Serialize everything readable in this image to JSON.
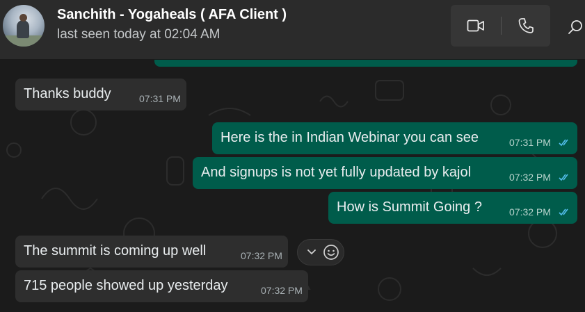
{
  "header": {
    "contact_name": "Sanchith - Yogaheals ( AFA Client )",
    "last_seen": "last seen today at 02:04 AM",
    "buttons": [
      "video-call-icon",
      "voice-call-icon",
      "search-icon"
    ]
  },
  "messages": [
    {
      "direction": "in",
      "text": "Thanks buddy",
      "time": "07:31 PM"
    },
    {
      "direction": "out",
      "text": "Here is the in Indian Webinar you can see",
      "time": "07:31 PM",
      "status": "read"
    },
    {
      "direction": "out",
      "text": "And signups is not yet fully updated by kajol",
      "time": "07:32 PM",
      "status": "read"
    },
    {
      "direction": "out",
      "text": "How is Summit Going ?",
      "time": "07:32 PM",
      "status": "read"
    },
    {
      "direction": "in",
      "text": "The summit is coming up well",
      "time": "07:32 PM"
    },
    {
      "direction": "in",
      "text": "715 people showed up yesterday",
      "time": "07:32 PM"
    }
  ],
  "hover_actions": [
    "chevron-down-icon",
    "emoji-icon"
  ],
  "colors": {
    "header_bg": "#2b2b2b",
    "chat_bg": "#1b1b1b",
    "incoming_bubble": "#2e2e2e",
    "outgoing_bubble": "#005c4b",
    "read_tick": "#53bdeb"
  }
}
